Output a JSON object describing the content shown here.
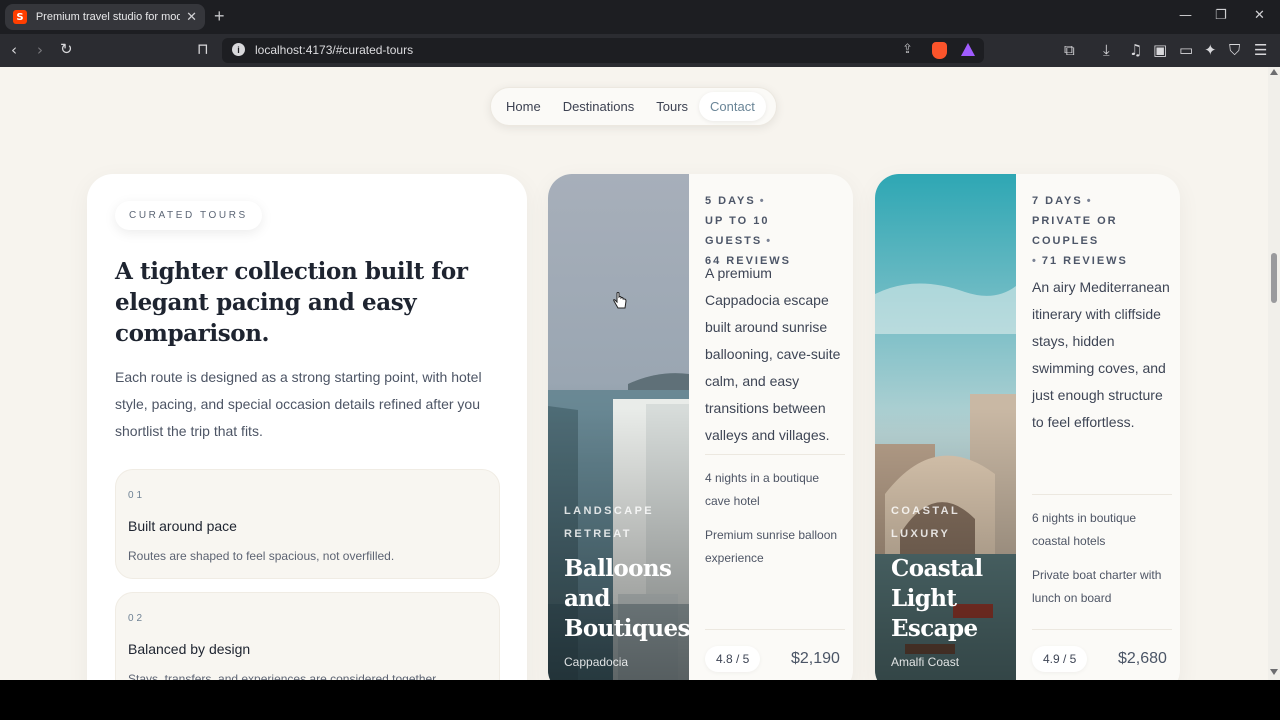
{
  "browser": {
    "tab_title": "Premium travel studio for moder",
    "tab_favicon": "S",
    "tab_close": "✕",
    "new_tab": "+",
    "url": "localhost:4173/#curated-tours",
    "window_controls": {
      "minimize": "—",
      "maximize": "❐",
      "close": "✕"
    },
    "icons": [
      "back-icon",
      "forward-icon",
      "reload-icon",
      "bookmark-icon",
      "info-icon",
      "share-icon",
      "brave-shields-icon",
      "brave-rewards-icon",
      "screenshot-icon",
      "download-icon",
      "media-icon",
      "sidebar-icon",
      "wallet-icon",
      "leo-ai-icon",
      "vpn-icon",
      "menu-icon"
    ]
  },
  "nav": {
    "items": [
      "Home",
      "Destinations",
      "Tours",
      "Contact"
    ],
    "active": "Contact"
  },
  "intro": {
    "eyebrow": "CURATED TOURS",
    "title": "A tighter collection built for elegant pacing and easy comparison.",
    "description": "Each route is designed as a strong starting point, with hotel style, pacing, and special occasion details refined after you shortlist the trip that fits.",
    "features": [
      {
        "num": "01",
        "title": "Built around pace",
        "desc": "Routes are shaped to feel spacious, not overfilled."
      },
      {
        "num": "02",
        "title": "Balanced by design",
        "desc": "Stays, transfers, and experiences are considered together."
      }
    ]
  },
  "tours": [
    {
      "kicker": "LANDSCAPE RETREAT",
      "name": "Balloons and Boutiques",
      "place": "Cappadocia",
      "meta_1": "5 DAYS",
      "meta_2": "UP TO 10 GUESTS",
      "meta_3": "64 REVIEWS",
      "description": "A premium Cappadocia escape built around sunrise ballooning, cave-suite calm, and easy transitions between valleys and villages.",
      "note_1": "4 nights in a boutique cave hotel",
      "note_2": "Premium sunrise balloon experience",
      "rating": "4.8 / 5",
      "price": "$2,190"
    },
    {
      "kicker": "COASTAL LUXURY",
      "name": "Coastal Light Escape",
      "place": "Amalfi Coast",
      "meta_1": "7 DAYS",
      "meta_2": "PRIVATE OR COUPLES",
      "meta_3": "71 REVIEWS",
      "description": "An airy Mediterranean itinerary with cliffside stays, hidden swimming coves, and just enough structure to feel effortless.",
      "note_1": "6 nights in boutique coastal hotels",
      "note_2": "Private boat charter with lunch on board",
      "rating": "4.9 / 5",
      "price": "$2,680"
    }
  ],
  "colors": {
    "page_bg": "#f7f4ee",
    "card_bg": "#fbfaf7",
    "accent": "#6a8597",
    "heading": "#1e2430",
    "chrome_bg": "#1d1e22"
  }
}
